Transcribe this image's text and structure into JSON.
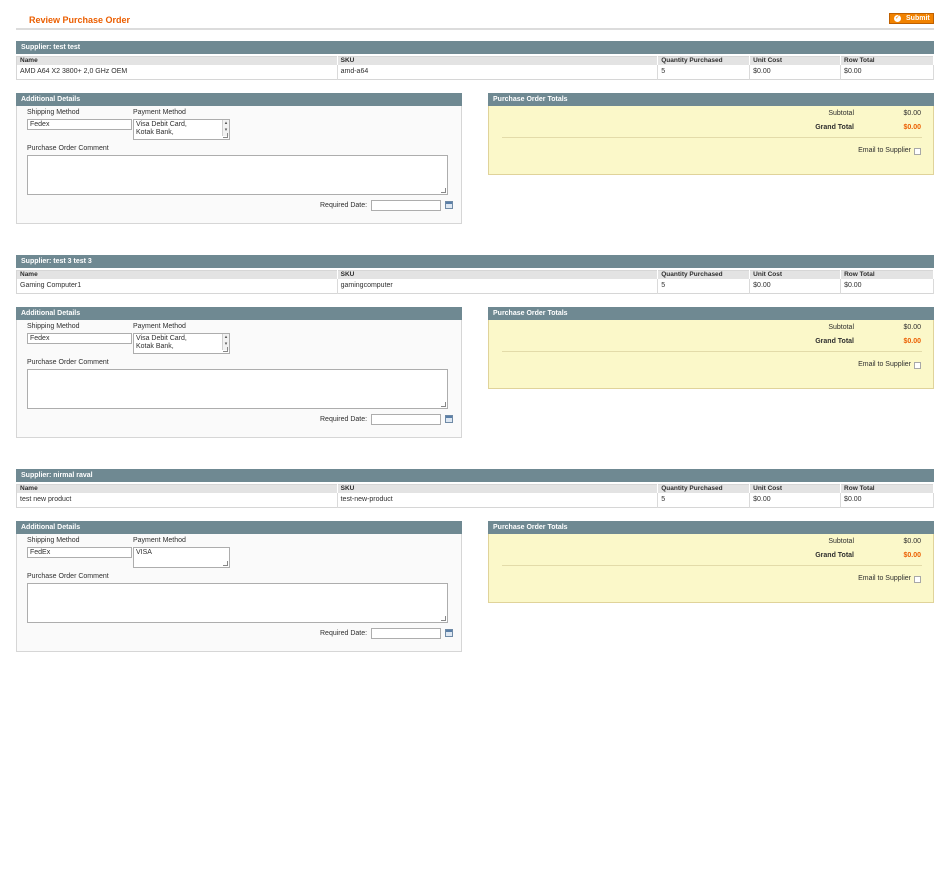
{
  "header": {
    "title": "Review Purchase Order",
    "submit_label": "Submit"
  },
  "columns": {
    "name": "Name",
    "sku": "SKU",
    "qty": "Quantity Purchased",
    "unit_cost": "Unit Cost",
    "row_total": "Row Total"
  },
  "labels": {
    "additional_details": "Additional Details",
    "shipping_method": "Shipping Method",
    "payment_method": "Payment Method",
    "po_comment": "Purchase Order Comment",
    "required_date": "Required Date:",
    "totals_title": "Purchase Order Totals",
    "subtotal": "Subtotal",
    "grand_total": "Grand Total",
    "email_to_supplier": "Email to Supplier"
  },
  "colors": {
    "accent": "#eb5e00",
    "header_bar": "#6f8992",
    "totals_bg": "#fbf8c9"
  },
  "icons": {
    "submit": "check-circle-icon",
    "calendar": "calendar-icon",
    "resize": "resize-grip-icon"
  },
  "orders": [
    {
      "supplier": "Supplier: test test",
      "item": {
        "name": "AMD A64 X2 3800+ 2,0 GHz OEM",
        "sku": "amd-a64",
        "qty": "5",
        "unit_cost": "$0.00",
        "row_total": "$0.00"
      },
      "shipping_method": "Fedex",
      "payment_method": "Visa Debit Card,\nKotak Bank,",
      "payment_scroll": true,
      "comment": "",
      "required_date": "",
      "subtotal": "$0.00",
      "grand_total": "$0.00"
    },
    {
      "supplier": "Supplier: test 3 test 3",
      "item": {
        "name": "Gaming Computer1",
        "sku": "gamingcomputer",
        "qty": "5",
        "unit_cost": "$0.00",
        "row_total": "$0.00"
      },
      "shipping_method": "Fedex",
      "payment_method": "Visa Debit Card,\nKotak Bank,",
      "payment_scroll": true,
      "comment": "",
      "required_date": "",
      "subtotal": "$0.00",
      "grand_total": "$0.00"
    },
    {
      "supplier": "Supplier: nirmal raval",
      "item": {
        "name": "test new product",
        "sku": "test-new-product",
        "qty": "5",
        "unit_cost": "$0.00",
        "row_total": "$0.00"
      },
      "shipping_method": "FedEx",
      "payment_method": "VISA",
      "payment_scroll": false,
      "comment": "",
      "required_date": "",
      "subtotal": "$0.00",
      "grand_total": "$0.00"
    }
  ]
}
